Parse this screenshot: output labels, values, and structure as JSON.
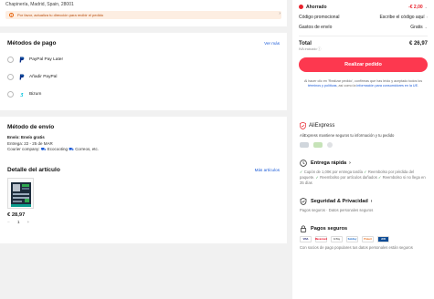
{
  "address": {
    "line": "Chapinería, Madrid, Spain, 28001",
    "warning": "Por favor, actualiza tu dirección para recibir el pedido"
  },
  "payment": {
    "title": "Métodos de pago",
    "see_more": "Ver más",
    "methods": [
      {
        "label": "PayPal Pay Later",
        "icon": "paypal-icon"
      },
      {
        "label": "Añadir PayPal",
        "icon": "paypal-icon"
      },
      {
        "label": "Bizum",
        "icon": "bizum-icon"
      }
    ]
  },
  "shipping": {
    "title": "Método de envío",
    "line1": "Envío: Envío gratis",
    "line2": "Entrega: 22 - 25 de MAR",
    "line3_prefix": "Courier company:",
    "line3_carriers": "Ecocooting",
    "line3_carriers2": "Correos",
    "line3_suffix": ", etc."
  },
  "item": {
    "title": "Detalle del artículo",
    "more": "Más artículos",
    "price": "€ 28,97",
    "quantity": "1",
    "minus": "−",
    "plus": "+"
  },
  "summary": {
    "saved_label": "Ahorrado",
    "saved_value": "-€ 2,00",
    "promo_label": "Código promocional",
    "promo_value": "Escribe el código aquí",
    "shipping_label": "Gastos de envío",
    "shipping_value": "Gratis",
    "total_label": "Total",
    "total_value": "€ 26,97",
    "vat": "IVA incluido",
    "button": "Realizar pedido",
    "legal_prefix": "Al hacer clic en 'Realizar pedido', confirmas que has leído y aceptado todos los",
    "legal_link1": "términos y políticas",
    "legal_mid": ", así como la",
    "legal_link2": "información para consumidores en la UE",
    "legal_end": "."
  },
  "trust": {
    "brand": "AliExpress",
    "brand_sub": "AliExpress mantiene seguros tu información y tu pedido",
    "delivery_title": "Entrega rápida",
    "delivery_text_1": "Cupón de 1,00€ por entrega tardía",
    "delivery_text_2": "Reembolso por pérdida del paquete.",
    "delivery_text_3": "Reembolso por artículos dañados",
    "delivery_text_4": "Reembolso si no llega en 35 días",
    "privacy_title": "Seguridad & Privacidad",
    "privacy_text": "Pagos seguros · Datos personales seguros",
    "secure_title": "Pagos seguros",
    "secure_text": "Con socios de pago populares tus datos personales están seguros",
    "pay_logos": [
      "VISA",
      "Mastercard",
      "G Pay",
      "SafeKey",
      "Protect",
      "JCB"
    ]
  },
  "colors": {
    "accent": "#fd384f",
    "link": "#1a5ad8",
    "saved": "#e8222c",
    "check": "#2a8a3a"
  }
}
